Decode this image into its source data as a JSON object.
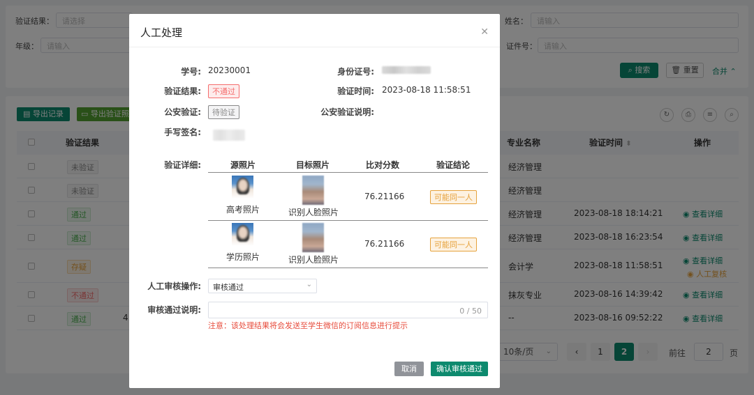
{
  "filters": {
    "result_label": "验证结果：",
    "result_placeholder": "请选择",
    "grade_label": "年级：",
    "grade_placeholder": "请输入",
    "name_label": "姓名：",
    "name_placeholder": "请输入",
    "cert_label": "证件号：",
    "cert_placeholder": "请输入",
    "search_label": "搜索",
    "reset_label": "重置",
    "merge_label": "合并"
  },
  "toolbar": {
    "export_label": "导出记录",
    "export2_label": "导出验证照片"
  },
  "table": {
    "headers": {
      "result": "验证结果",
      "major": "专业名称",
      "time": "验证时间",
      "action": "操作"
    },
    "rows": [
      {
        "status": "未验证",
        "status_type": "gray",
        "partial": "",
        "major": "经济管理",
        "time": "",
        "action": "",
        "action2": ""
      },
      {
        "status": "未验证",
        "status_type": "gray",
        "partial": "",
        "major": "经济管理",
        "time": "",
        "action": "",
        "action2": ""
      },
      {
        "status": "通过",
        "status_type": "green",
        "partial": "",
        "major": "经济管理",
        "time": "2023-08-18 18:14:21",
        "action": "查看详细",
        "action2": ""
      },
      {
        "status": "通过",
        "status_type": "green",
        "partial": "",
        "major": "经济管理",
        "time": "2023-08-18 16:23:54",
        "action": "查看详细",
        "action2": ""
      },
      {
        "status": "存疑",
        "status_type": "orange",
        "partial": "",
        "major": "会计学",
        "time": "2023-08-18 11:58:51",
        "action": "查看详细",
        "action2": "人工复核"
      },
      {
        "status": "不通过",
        "status_type": "red",
        "partial": "",
        "major": "抹灰专业",
        "time": "2023-08-16 14:39:42",
        "action": "查看详细",
        "action2": ""
      },
      {
        "status": "通过",
        "status_type": "green",
        "partial": "4",
        "major": "--",
        "time": "2023-08-16 09:52:22",
        "action": "查看详细",
        "action2": ""
      }
    ]
  },
  "pagination": {
    "page_size": "10条/页",
    "pages": [
      "1",
      "2"
    ],
    "current": "2",
    "goto_label": "前往",
    "goto_value": "2",
    "page_unit": "页"
  },
  "dialog": {
    "title": "人工处理",
    "student_id_label": "学号:",
    "student_id": "20230001",
    "id_card_label": "身份证号:",
    "verify_result_label": "验证结果:",
    "verify_result": "不通过",
    "verify_time_label": "验证时间:",
    "verify_time": "2023-08-18 11:58:51",
    "police_label": "公安验证:",
    "police_status": "待验证",
    "police_desc_label": "公安验证说明:",
    "signature_label": "手写签名:",
    "detail_label": "验证详细:",
    "detail_headers": {
      "source": "源照片",
      "target": "目标照片",
      "score": "比对分数",
      "conclusion": "验证结论"
    },
    "detail_rows": [
      {
        "source_caption": "高考照片",
        "target_caption": "识别人脸照片",
        "score": "76.21166",
        "conclusion": "可能同一人"
      },
      {
        "source_caption": "学历照片",
        "target_caption": "识别人脸照片",
        "score": "76.21166",
        "conclusion": "可能同一人"
      }
    ],
    "manual_op_label": "人工审核操作:",
    "manual_op_value": "审核通过",
    "pass_desc_label": "审核通过说明:",
    "pass_desc_count": "0 / 50",
    "note": "注意：该处理结果将会发送至学生微信的订阅信息进行提示",
    "cancel_label": "取消",
    "confirm_label": "确认审核通过"
  },
  "colors": {
    "primary": "#0d8a6e",
    "danger": "#f56c6c",
    "warning": "#e6a23c",
    "success": "#4caf50"
  }
}
